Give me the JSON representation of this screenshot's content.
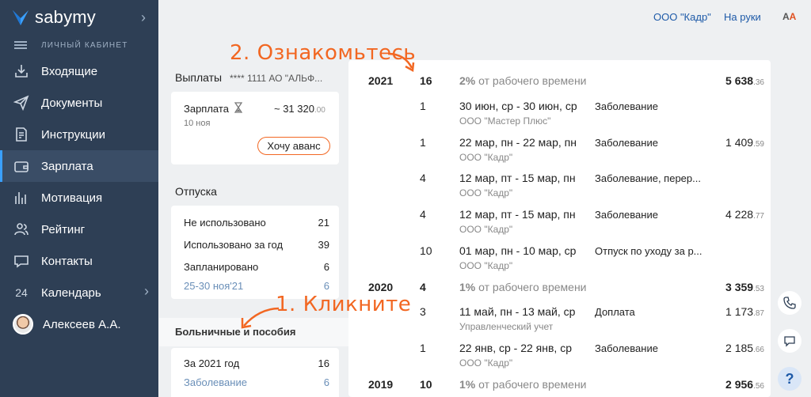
{
  "sidebar": {
    "logo": "sabymy",
    "subtitle": "ЛИЧНЫЙ КАБИНЕТ",
    "items": [
      {
        "label": "Входящие"
      },
      {
        "label": "Документы"
      },
      {
        "label": "Инструкции"
      },
      {
        "label": "Зарплата"
      },
      {
        "label": "Мотивация"
      },
      {
        "label": "Рейтинг"
      },
      {
        "label": "Контакты"
      },
      {
        "label": "Календарь",
        "number": "24"
      },
      {
        "label": "Алексеев А.А."
      }
    ]
  },
  "topbar": {
    "org": "ООО \"Кадр\"",
    "hands": "На руки",
    "font_toggle_a": "A",
    "font_toggle_b": "A"
  },
  "payments": {
    "title": "Выплаты",
    "account": "**** 1111  АО \"АЛЬФ...",
    "salary_label": "Зарплата",
    "salary_date": "10 ноя",
    "salary_amount": "~ 31 320",
    "salary_cents": ".00",
    "advance_button": "Хочу аванс"
  },
  "vacations": {
    "title": "Отпуска",
    "rows": [
      {
        "label": "Не использовано",
        "value": "21"
      },
      {
        "label": "Использовано за год",
        "value": "39"
      },
      {
        "label": "Запланировано",
        "value": "6"
      },
      {
        "label": "25-30 ноя'21",
        "value": "6"
      }
    ]
  },
  "sick": {
    "title": "Больничные и пособия",
    "rows": [
      {
        "label": "За 2021 год",
        "value": "16"
      },
      {
        "label": "Заболевание",
        "value": "6"
      }
    ]
  },
  "table": {
    "rows": [
      {
        "kind": "year",
        "year": "2021",
        "count": "16",
        "pct": "2%",
        "pct_text": " от рабочего времени",
        "sum": "5 638",
        "cents": ".36"
      },
      {
        "kind": "item",
        "count": "1",
        "dates": "30 июн, ср - 30 июн, ср",
        "org": "ООО \"Мастер Плюс\"",
        "type": "Заболевание",
        "sum": "",
        "cents": ""
      },
      {
        "kind": "item",
        "count": "1",
        "dates": "22 мар, пн - 22 мар, пн",
        "org": "ООО \"Кадр\"",
        "type": "Заболевание",
        "sum": "1 409",
        "cents": ".59"
      },
      {
        "kind": "item",
        "count": "4",
        "dates": "12 мар, пт - 15 мар, пн",
        "org": "ООО \"Кадр\"",
        "type": "Заболевание, перер...",
        "sum": "",
        "cents": ""
      },
      {
        "kind": "item",
        "count": "4",
        "dates": "12 мар, пт - 15 мар, пн",
        "org": "ООО \"Кадр\"",
        "type": "Заболевание",
        "sum": "4 228",
        "cents": ".77"
      },
      {
        "kind": "item",
        "count": "10",
        "dates": "01 мар, пн - 10 мар, ср",
        "org": "ООО \"Кадр\"",
        "type": "Отпуск по уходу за р...",
        "sum": "",
        "cents": ""
      },
      {
        "kind": "year",
        "year": "2020",
        "count": "4",
        "pct": "1%",
        "pct_text": " от рабочего времени",
        "sum": "3 359",
        "cents": ".53"
      },
      {
        "kind": "item",
        "count": "3",
        "dates": "11 май, пн - 13 май, ср",
        "org": "Управленческий учет",
        "type": "Доплата",
        "sum": "1 173",
        "cents": ".87"
      },
      {
        "kind": "item",
        "count": "1",
        "dates": "22 янв, ср - 22 янв, ср",
        "org": "ООО \"Кадр\"",
        "type": "Заболевание",
        "sum": "2 185",
        "cents": ".66"
      },
      {
        "kind": "year",
        "year": "2019",
        "count": "10",
        "pct": "1%",
        "pct_text": " от рабочего времени",
        "sum": "2 956",
        "cents": ".56"
      }
    ]
  },
  "annotations": {
    "step1": "1. Кликните",
    "step2": "2. Ознакомьтесь"
  },
  "colors": {
    "sidebar_bg": "#2e3f55",
    "accent": "#f26722",
    "link": "#1e5aa8"
  }
}
